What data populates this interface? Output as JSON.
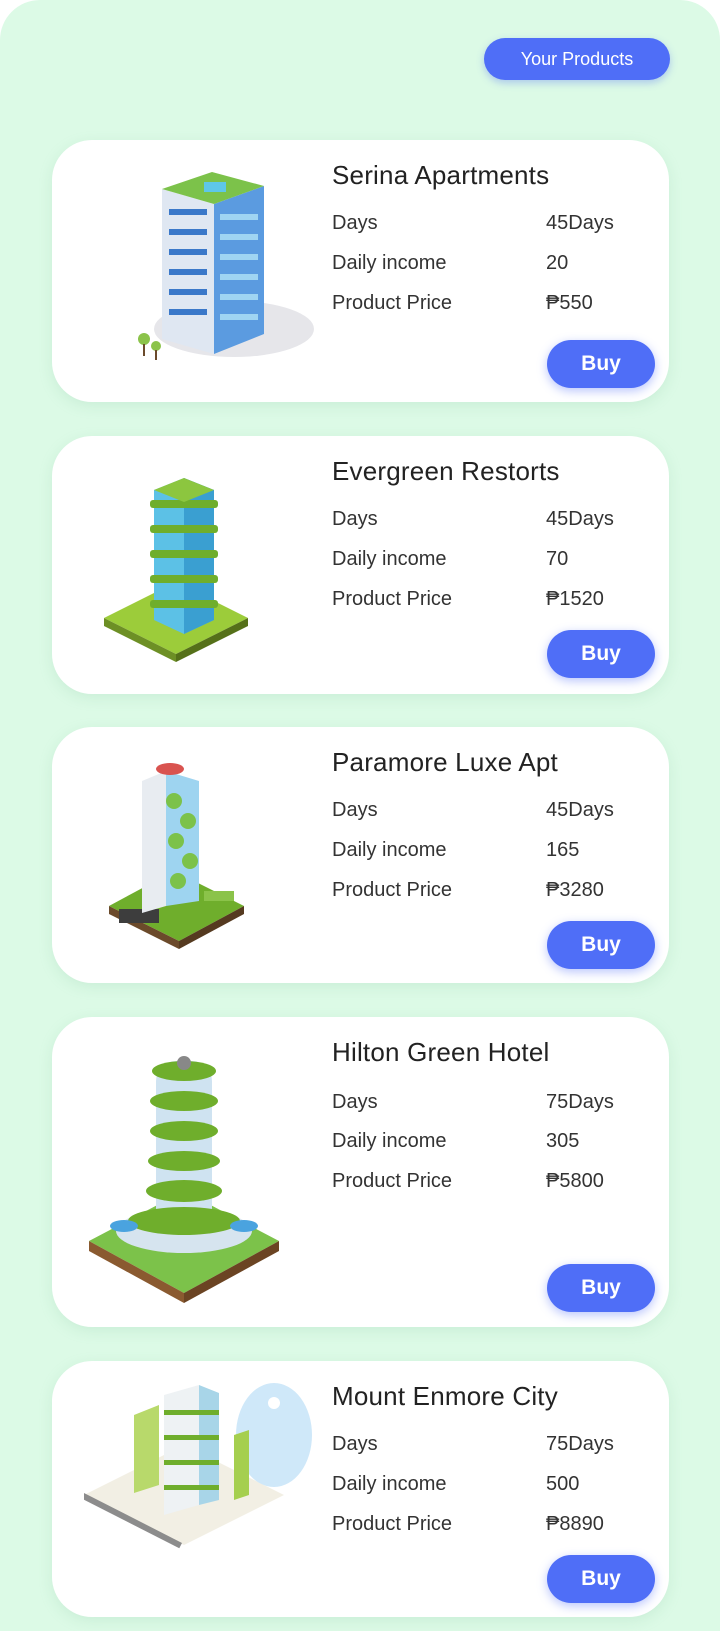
{
  "header": {
    "your_products_label": "Your Products"
  },
  "products": [
    {
      "name": "Serina Apartments",
      "days_label": "Days",
      "days": "45Days",
      "income_label": "Daily income",
      "income": "20",
      "price_label": "Product Price",
      "price": "₱550",
      "buy_label": "Buy",
      "image_icon": "apartment-building-icon"
    },
    {
      "name": "Evergreen Restorts",
      "days_label": "Days",
      "days": "45Days",
      "income_label": "Daily income",
      "income": "70",
      "price_label": "Product Price",
      "price": "₱1520",
      "buy_label": "Buy",
      "image_icon": "green-tower-icon"
    },
    {
      "name": "Paramore Luxe Apt",
      "days_label": "Days",
      "days": "45Days",
      "income_label": "Daily income",
      "income": "165",
      "price_label": "Product Price",
      "price": "₱3280",
      "buy_label": "Buy",
      "image_icon": "helipad-tower-icon"
    },
    {
      "name": "Hilton Green Hotel",
      "days_label": "Days",
      "days": "75Days",
      "income_label": "Daily income",
      "income": "305",
      "price_label": "Product Price",
      "price": "₱5800",
      "buy_label": "Buy",
      "image_icon": "round-green-hotel-icon"
    },
    {
      "name": "Mount Enmore City",
      "days_label": "Days",
      "days": "75Days",
      "income_label": "Daily income",
      "income": "500",
      "price_label": "Product Price",
      "price": "₱8890",
      "buy_label": "Buy",
      "image_icon": "city-block-icon"
    }
  ],
  "colors": {
    "background": "#dcfae6",
    "accent": "#4f6ef7",
    "card": "#ffffff"
  }
}
